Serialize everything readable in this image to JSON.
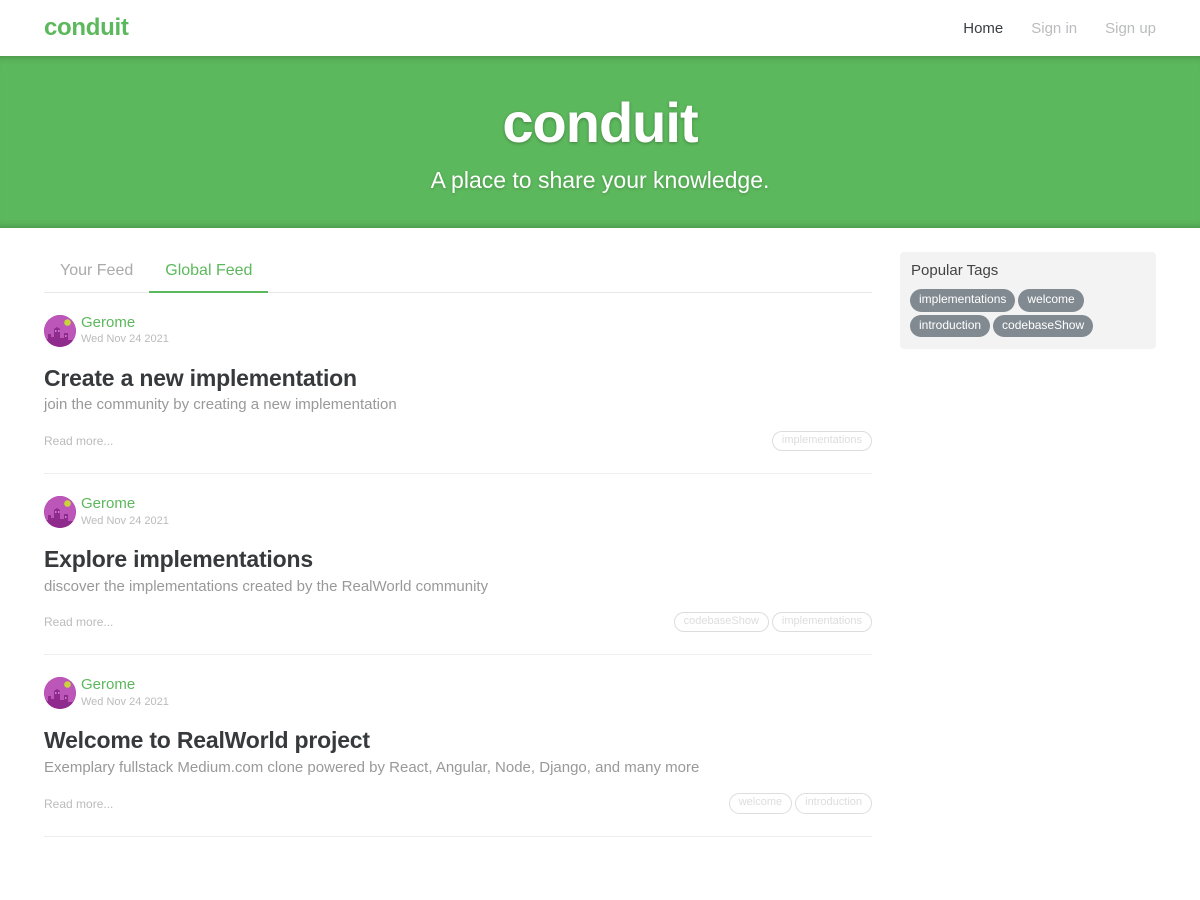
{
  "navbar": {
    "brand": "conduit",
    "links": [
      {
        "label": "Home",
        "active": true
      },
      {
        "label": "Sign in",
        "active": false
      },
      {
        "label": "Sign up",
        "active": false
      }
    ]
  },
  "banner": {
    "title": "conduit",
    "subtitle": "A place to share your knowledge.",
    "bg_color": "#5CB85C"
  },
  "feed": {
    "tabs": [
      {
        "label": "Your Feed",
        "active": false
      },
      {
        "label": "Global Feed",
        "active": true
      }
    ],
    "read_more_label": "Read more...",
    "articles": [
      {
        "author": "Gerome",
        "date": "Wed Nov 24 2021",
        "title": "Create a new implementation",
        "description": "join the community by creating a new implementation",
        "tags": [
          "implementations"
        ]
      },
      {
        "author": "Gerome",
        "date": "Wed Nov 24 2021",
        "title": "Explore implementations",
        "description": "discover the implementations created by the RealWorld community",
        "tags": [
          "codebaseShow",
          "implementations"
        ]
      },
      {
        "author": "Gerome",
        "date": "Wed Nov 24 2021",
        "title": "Welcome to RealWorld project",
        "description": "Exemplary fullstack Medium.com clone powered by React, Angular, Node, Django, and many more",
        "tags": [
          "welcome",
          "introduction"
        ]
      }
    ]
  },
  "sidebar": {
    "title": "Popular Tags",
    "tags": [
      "implementations",
      "welcome",
      "introduction",
      "codebaseShow"
    ],
    "bg_color": "#f3f3f3",
    "pill_color": "#818a91"
  },
  "theme": {
    "brand_green": "#5CB85C",
    "text_dark": "#373a3c",
    "text_muted": "#bbbbbb"
  }
}
